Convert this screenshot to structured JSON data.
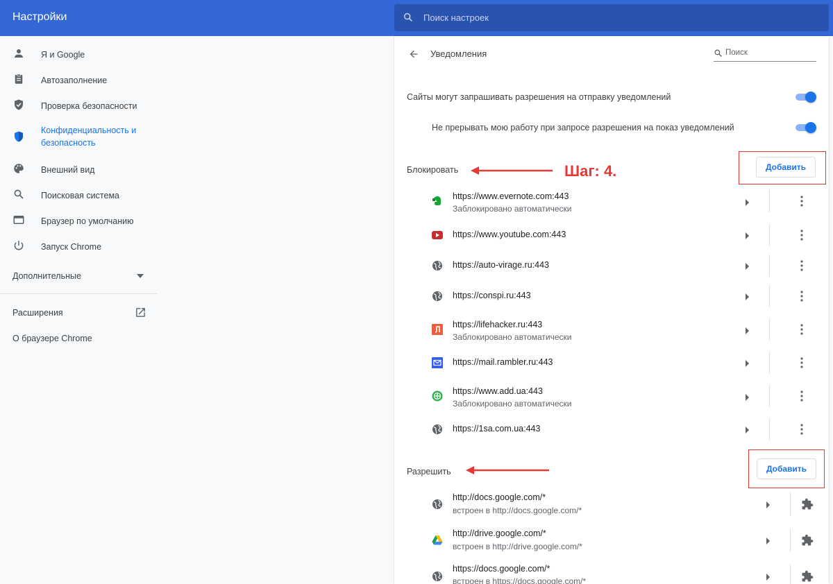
{
  "header": {
    "title": "Настройки",
    "search_placeholder": "Поиск настроек"
  },
  "sidebar": {
    "items": [
      {
        "label": "Я и Google",
        "icon": "person-icon"
      },
      {
        "label": "Автозаполнение",
        "icon": "clipboard-icon"
      },
      {
        "label": "Проверка безопасности",
        "icon": "shield-check-icon"
      },
      {
        "label": "Конфиденциальность и безопасность",
        "icon": "shield-icon",
        "active": true
      },
      {
        "label": "Внешний вид",
        "icon": "palette-icon"
      },
      {
        "label": "Поисковая система",
        "icon": "search-icon"
      },
      {
        "label": "Браузер по умолчанию",
        "icon": "browser-icon"
      },
      {
        "label": "Запуск Chrome",
        "icon": "power-icon"
      }
    ],
    "advanced": "Дополнительные",
    "extensions": "Расширения",
    "about": "О браузере Chrome"
  },
  "page": {
    "title": "Уведомления",
    "search_placeholder": "Поиск",
    "setting_1": "Сайты могут запрашивать разрешения на отправку уведомлений",
    "setting_2": "Не прерывать мою работу при запросе разрешения на показ уведомлений",
    "block_label": "Блокировать",
    "allow_label": "Разрешить",
    "add_label": "Добавить",
    "annotation": "Шаг: 4."
  },
  "blocked_sites": [
    {
      "url": "https://www.evernote.com:443",
      "sub": "Заблокировано автоматически",
      "icon": "evernote-icon"
    },
    {
      "url": "https://www.youtube.com:443",
      "sub": "",
      "icon": "youtube-icon"
    },
    {
      "url": "https://auto-virage.ru:443",
      "sub": "",
      "icon": "globe-icon"
    },
    {
      "url": "https://conspi.ru:443",
      "sub": "",
      "icon": "globe-icon"
    },
    {
      "url": "https://lifehacker.ru:443",
      "sub": "Заблокировано автоматически",
      "icon": "lifehacker-icon"
    },
    {
      "url": "https://mail.rambler.ru:443",
      "sub": "",
      "icon": "mail-icon"
    },
    {
      "url": "https://www.add.ua:443",
      "sub": "Заблокировано автоматически",
      "icon": "add-ua-icon"
    },
    {
      "url": "https://1sa.com.ua:443",
      "sub": "",
      "icon": "globe-icon"
    }
  ],
  "allowed_sites": [
    {
      "url": "http://docs.google.com/*",
      "sub": "встроен в http://docs.google.com/*",
      "icon": "globe-icon"
    },
    {
      "url": "http://drive.google.com/*",
      "sub": "встроен в http://drive.google.com/*",
      "icon": "google-drive-icon"
    },
    {
      "url": "https://docs.google.com/*",
      "sub": "встроен в https://docs.google.com/*",
      "icon": "globe-icon"
    }
  ],
  "colors": {
    "header": "#3467d6",
    "accent": "#1a73e8",
    "annotation": "#e53935"
  }
}
